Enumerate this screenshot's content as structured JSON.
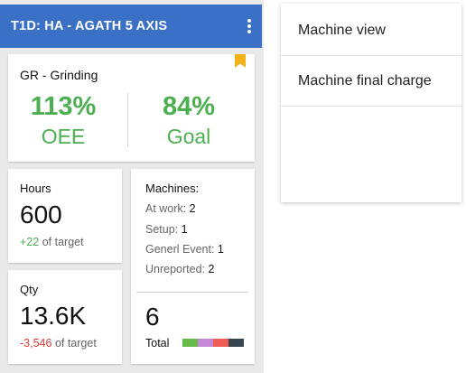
{
  "header": {
    "title": "T1D: HA - AGATH 5 AXIS",
    "color": "#3a70c6",
    "menu_icon": "more-vert-icon"
  },
  "oee_card": {
    "department": "GR - Grinding",
    "oee_value": "113%",
    "oee_label": "OEE",
    "goal_value": "84%",
    "goal_label": "Goal",
    "bookmark_color": "#f3b21a",
    "value_color": "#4caf50"
  },
  "hours_card": {
    "label": "Hours",
    "value": "600",
    "delta": "+22",
    "suffix": "of target"
  },
  "qty_card": {
    "label": "Qty",
    "value": "13.6K",
    "delta": "-3,546",
    "suffix": "of target"
  },
  "machines_card": {
    "title": "Machines:",
    "rows": [
      {
        "label": "At work:",
        "value": "2"
      },
      {
        "label": "Setup:",
        "value": "1"
      },
      {
        "label": "Generl Event:",
        "value": "1"
      },
      {
        "label": "Unreported:",
        "value": "2"
      }
    ],
    "total_value": "6",
    "total_label": "Total",
    "status_colors": [
      "#66bb4a",
      "#c488d8",
      "#ef5d55",
      "#37474f"
    ]
  },
  "menu": {
    "items": [
      {
        "label": "Machine view"
      },
      {
        "label": "Machine final charge"
      }
    ]
  }
}
